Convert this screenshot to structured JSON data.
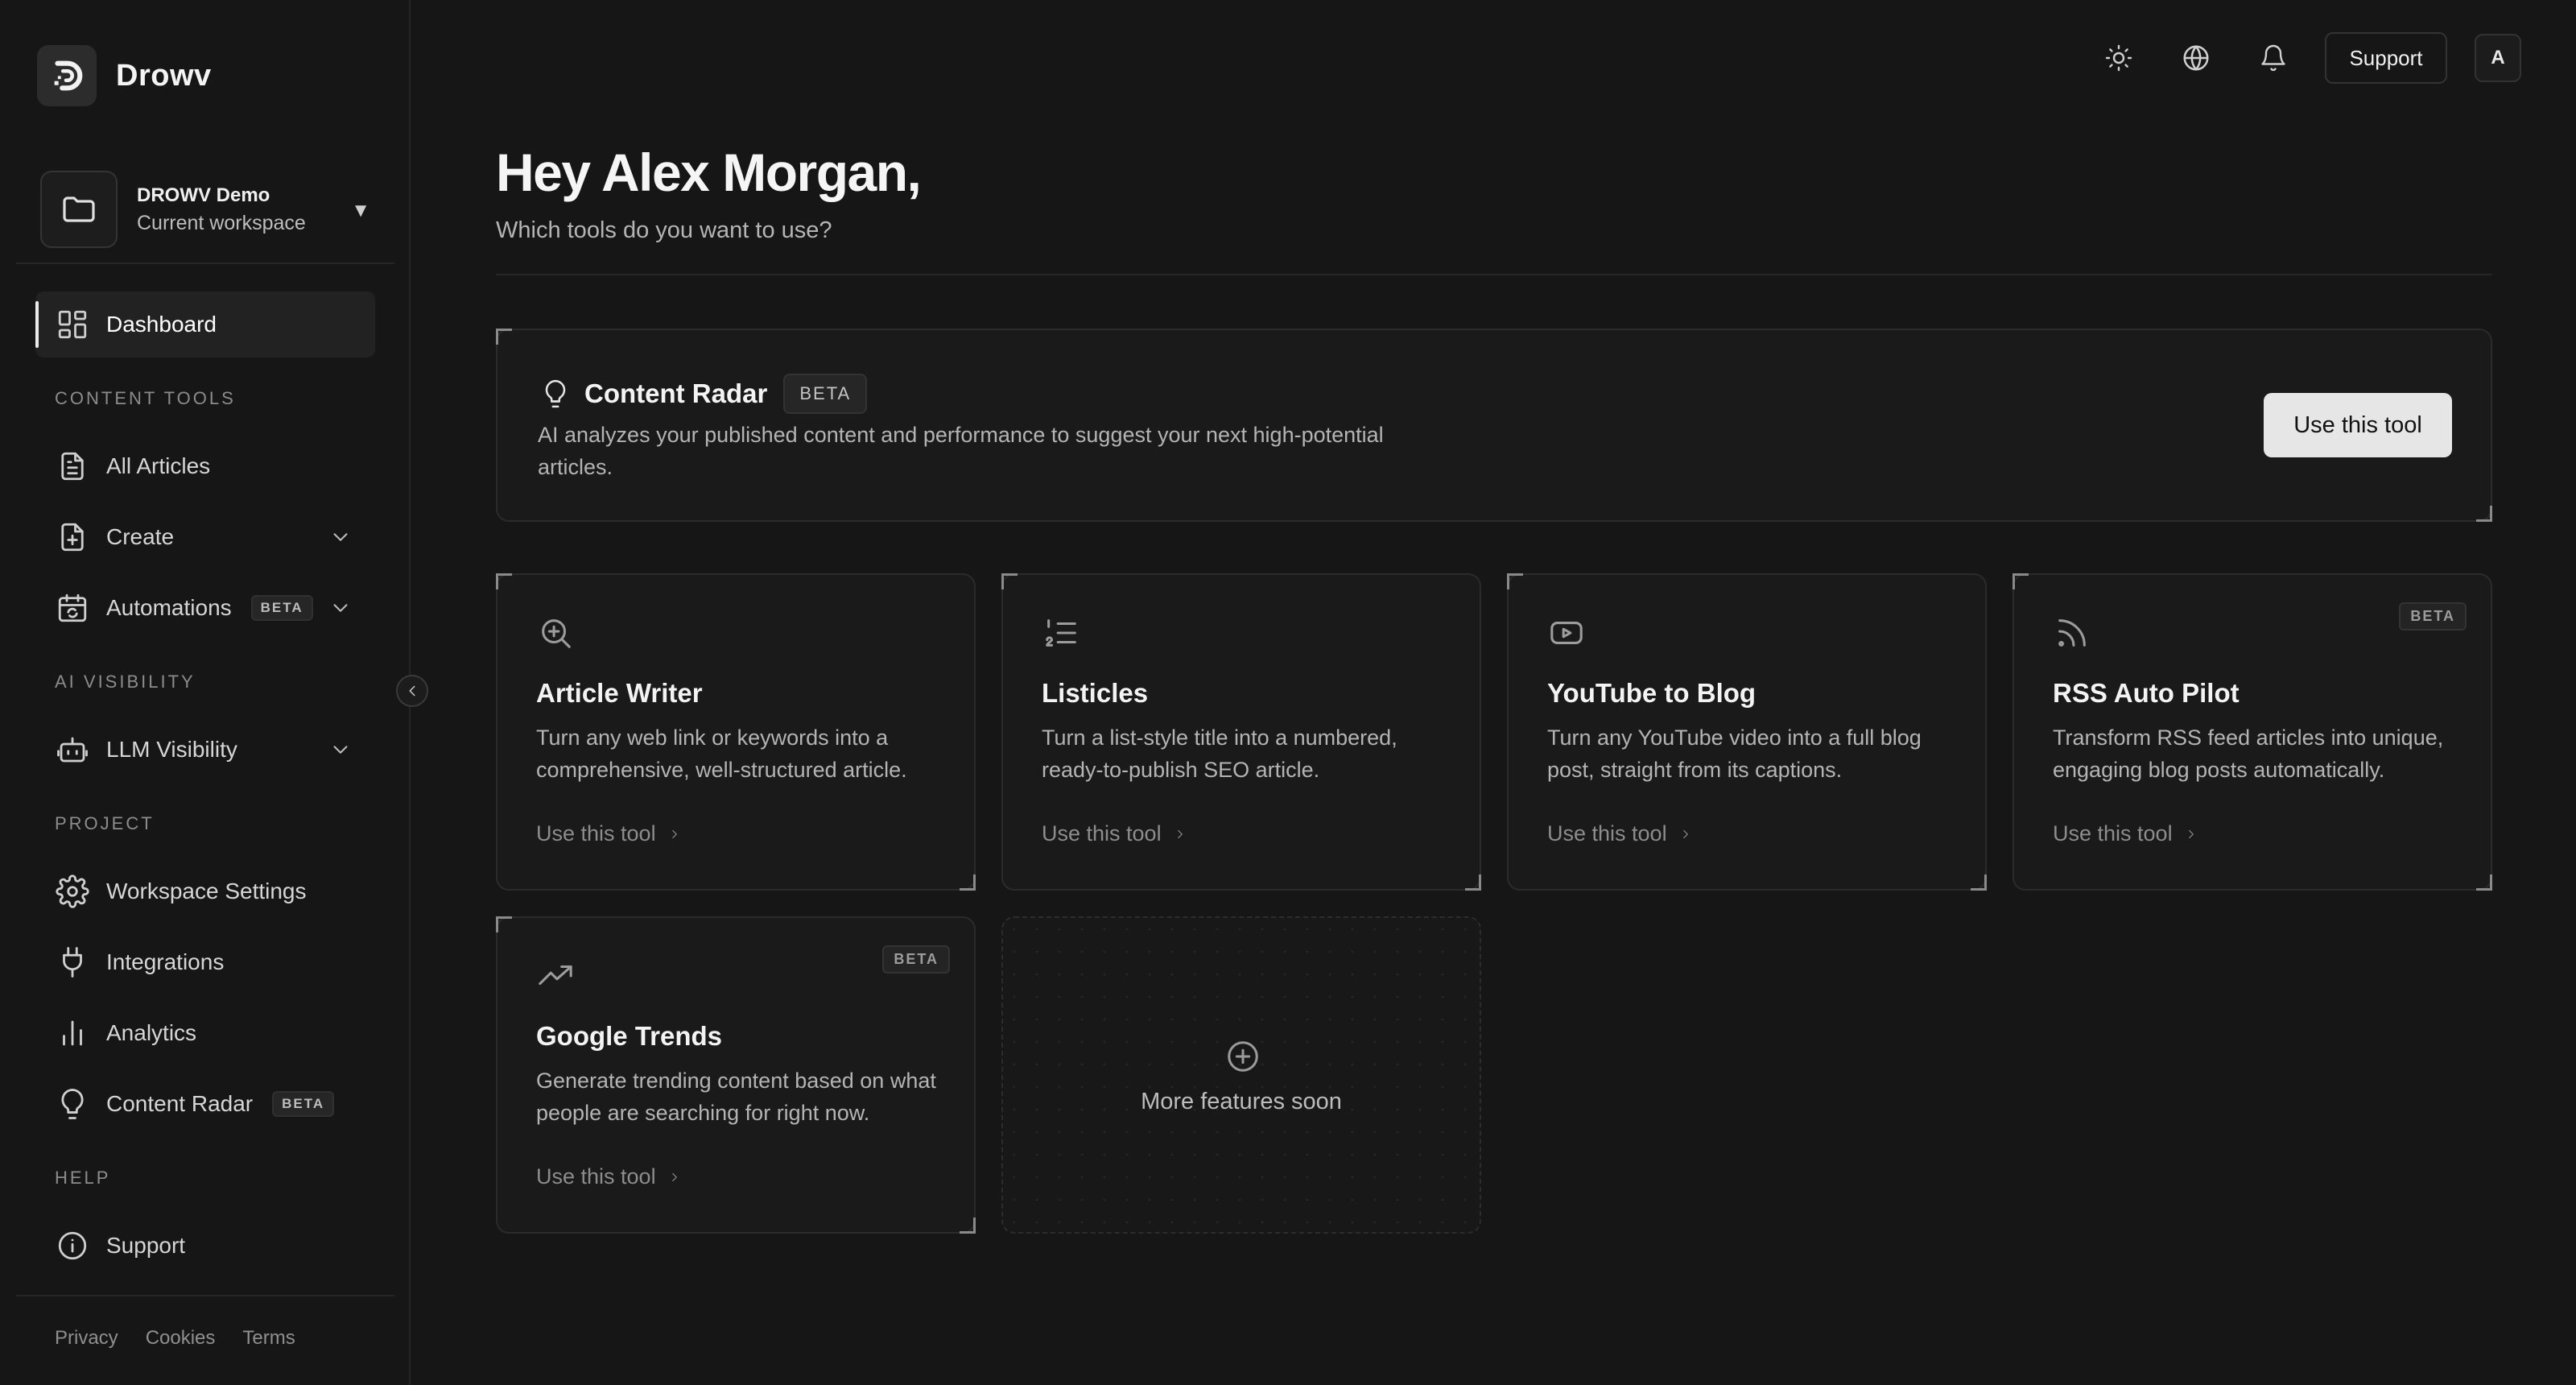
{
  "brand": {
    "name": "Drowv"
  },
  "workspace": {
    "name": "DROWV Demo",
    "subtitle": "Current workspace",
    "caret": "▼"
  },
  "sidebar": {
    "dashboard": "Dashboard",
    "sections": {
      "content_tools": "CONTENT TOOLS",
      "ai_visibility": "AI VISIBILITY",
      "project": "PROJECT",
      "help": "HELP"
    },
    "items": {
      "all_articles": "All Articles",
      "create": "Create",
      "automations": "Automations",
      "automations_badge": "BETA",
      "llm_visibility": "LLM Visibility",
      "workspace_settings": "Workspace Settings",
      "integrations": "Integrations",
      "analytics": "Analytics",
      "content_radar": "Content Radar",
      "content_radar_badge": "BETA",
      "support": "Support"
    },
    "footer": {
      "privacy": "Privacy",
      "cookies": "Cookies",
      "terms": "Terms"
    }
  },
  "topbar": {
    "support": "Support",
    "avatar_initial": "A"
  },
  "main": {
    "greeting": "Hey Alex Morgan,",
    "subtitle": "Which tools do you want to use?",
    "featured": {
      "title": "Content Radar",
      "badge": "BETA",
      "description": "AI analyzes your published content and performance to suggest your next high-potential articles.",
      "button": "Use this tool"
    },
    "tools": {
      "article_writer": {
        "title": "Article Writer",
        "description": "Turn any web link or keywords into a comprehensive, well-structured article.",
        "link": "Use this tool"
      },
      "listicles": {
        "title": "Listicles",
        "description": "Turn a list-style title into a numbered, ready-to-publish SEO article.",
        "link": "Use this tool"
      },
      "youtube_to_blog": {
        "title": "YouTube to Blog",
        "description": "Turn any YouTube video into a full blog post, straight from its captions.",
        "link": "Use this tool"
      },
      "rss_auto_pilot": {
        "title": "RSS Auto Pilot",
        "badge": "BETA",
        "description": "Transform RSS feed articles into unique, engaging blog posts automatically.",
        "link": "Use this tool"
      },
      "google_trends": {
        "title": "Google Trends",
        "badge": "BETA",
        "description": "Generate trending content based on what people are searching for right now.",
        "link": "Use this tool"
      }
    },
    "coming_soon": "More features soon"
  }
}
